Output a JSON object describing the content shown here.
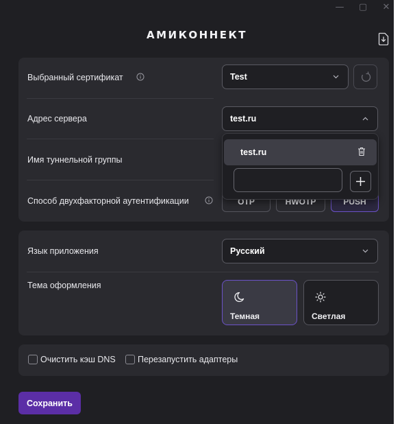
{
  "window_controls": {
    "minimize": "—",
    "maximize": "▢",
    "close": "✕"
  },
  "app": {
    "title": "АМИКОННЕКТ",
    "export_icon": "file-download-icon"
  },
  "connection": {
    "certificate": {
      "label": "Выбранный сертификат",
      "value": "Test"
    },
    "server": {
      "label": "Адрес сервера",
      "value": "test.ru"
    },
    "tunnel_group": {
      "label": "Имя туннельной группы"
    },
    "two_factor": {
      "label": "Способ двухфакторной аутентификации",
      "options": [
        "OTP",
        "HWOTP",
        "PUSH"
      ],
      "selected": "PUSH"
    }
  },
  "server_dropdown": {
    "items": [
      "test.ru"
    ],
    "new_value": "",
    "add_label": "+"
  },
  "preferences": {
    "language": {
      "label": "Язык приложения",
      "value": "Русский"
    },
    "theme": {
      "label": "Тема оформления",
      "options": [
        "Темная",
        "Светлая"
      ],
      "selected": "Темная"
    }
  },
  "maintenance": {
    "clear_dns": "Очистить кэш DNS",
    "restart_adapters": "Перезапустить адаптеры"
  },
  "footer": {
    "save_label": "Сохранить"
  },
  "colors": {
    "background": "#1f1f23",
    "panel": "#2a2a2f",
    "accent": "#5b2ea6",
    "accent_border": "#6b52c8"
  }
}
